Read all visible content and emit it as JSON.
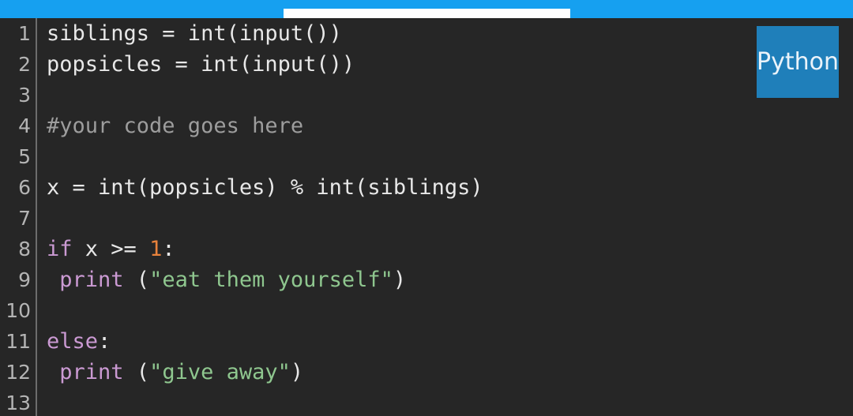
{
  "window": {
    "title": "Python code editor",
    "background_color": "#262626"
  },
  "topbar": {
    "name": "progress-bar",
    "color": "#16a0f0",
    "indicator_color": "#ffffff"
  },
  "language_badge": {
    "label": "Python",
    "background_color": "#1f7fba",
    "text_color": "#eaf3fa"
  },
  "editor": {
    "gutter_color": "#b4b4b4",
    "separator_color": "#6d6d6d",
    "line_numbers": [
      "1",
      "2",
      "3",
      "4",
      "5",
      "6",
      "7",
      "8",
      "9",
      "10",
      "11",
      "12",
      "13"
    ],
    "lines": [
      {
        "number": "1",
        "text": "siblings = int(input())",
        "tokens": [
          {
            "t": "siblings = int(input())",
            "c": "tok-plain"
          }
        ]
      },
      {
        "number": "2",
        "text": "popsicles = int(input())",
        "tokens": [
          {
            "t": "popsicles = int(input())",
            "c": "tok-plain"
          }
        ]
      },
      {
        "number": "3",
        "text": "",
        "tokens": []
      },
      {
        "number": "4",
        "text": "#your code goes here",
        "tokens": [
          {
            "t": "#your code goes here",
            "c": "tok-comment"
          }
        ]
      },
      {
        "number": "5",
        "text": "",
        "tokens": []
      },
      {
        "number": "6",
        "text": "x = int(popsicles) % int(siblings)",
        "tokens": [
          {
            "t": "x = int(popsicles) % int(siblings)",
            "c": "tok-plain"
          }
        ]
      },
      {
        "number": "7",
        "text": "",
        "tokens": []
      },
      {
        "number": "8",
        "text": "if x >= 1:",
        "tokens": [
          {
            "t": "if",
            "c": "tok-keyword"
          },
          {
            "t": " x >= ",
            "c": "tok-plain"
          },
          {
            "t": "1",
            "c": "tok-number"
          },
          {
            "t": ":",
            "c": "tok-punct"
          }
        ]
      },
      {
        "number": "9",
        "text": " print (\"eat them yourself\")",
        "tokens": [
          {
            "t": " ",
            "c": "tok-plain"
          },
          {
            "t": "print",
            "c": "tok-func"
          },
          {
            "t": " (",
            "c": "tok-punct"
          },
          {
            "t": "\"eat them yourself\"",
            "c": "tok-string"
          },
          {
            "t": ")",
            "c": "tok-punct"
          }
        ]
      },
      {
        "number": "10",
        "text": "",
        "tokens": []
      },
      {
        "number": "11",
        "text": "else:",
        "tokens": [
          {
            "t": "else",
            "c": "tok-keyword"
          },
          {
            "t": ":",
            "c": "tok-punct"
          }
        ]
      },
      {
        "number": "12",
        "text": " print (\"give away\")",
        "tokens": [
          {
            "t": " ",
            "c": "tok-plain"
          },
          {
            "t": "print",
            "c": "tok-func"
          },
          {
            "t": " (",
            "c": "tok-punct"
          },
          {
            "t": "\"give away\"",
            "c": "tok-string"
          },
          {
            "t": ")",
            "c": "tok-punct"
          }
        ]
      },
      {
        "number": "13",
        "text": "",
        "tokens": []
      }
    ]
  }
}
